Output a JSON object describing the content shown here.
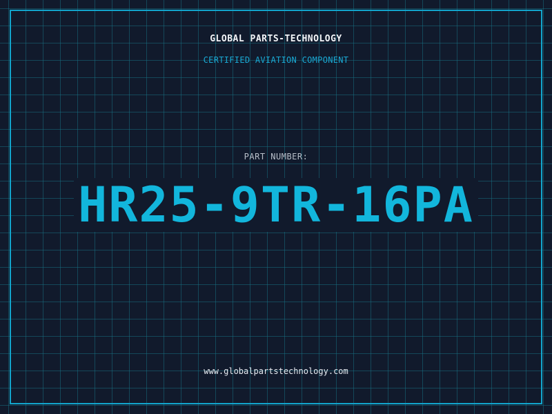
{
  "header": {
    "company": "GLOBAL PARTS-TECHNOLOGY",
    "subtitle": "CERTIFIED AVIATION COMPONENT"
  },
  "part": {
    "label": "PART NUMBER:",
    "number": "HR25-9TR-16PA"
  },
  "footer": {
    "url": "www.globalpartstechnology.com"
  },
  "colors": {
    "background": "#111a2c",
    "grid": "#166e80",
    "accent": "#12b6dc",
    "frame": "#12a5cc"
  }
}
